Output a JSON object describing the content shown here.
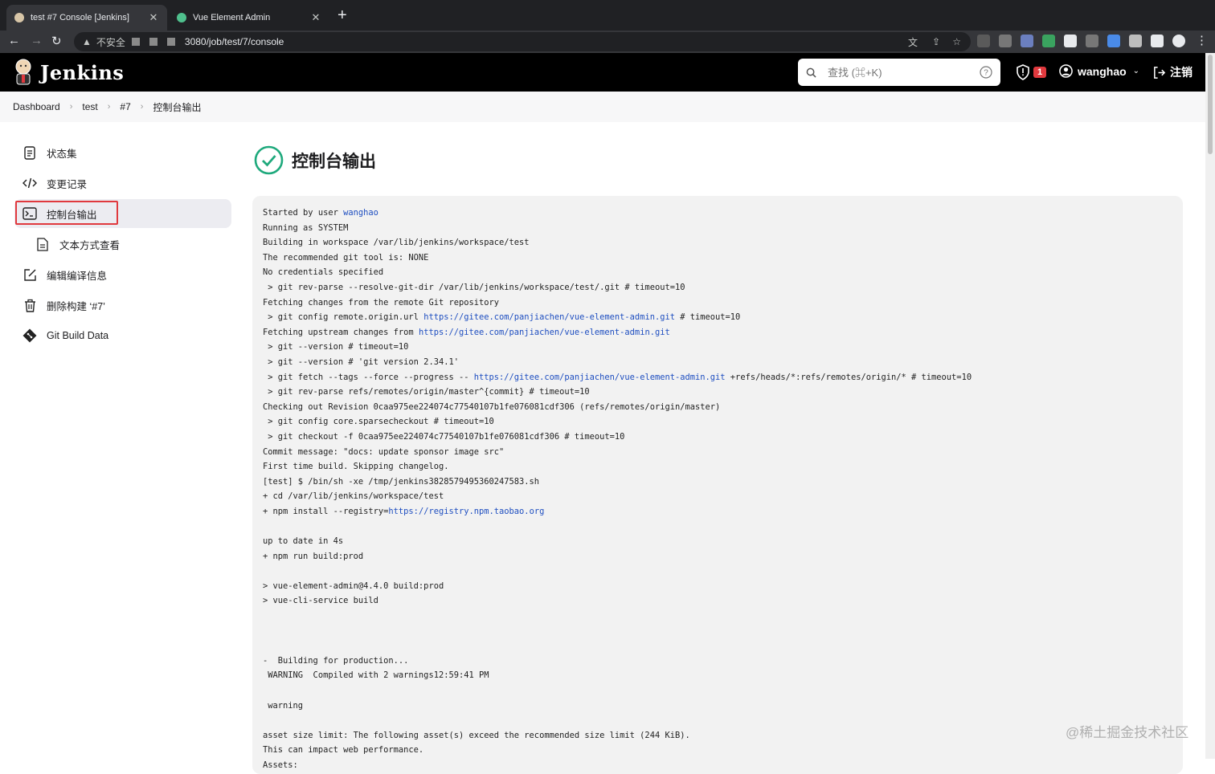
{
  "browser": {
    "tabs": [
      {
        "title": "test #7 Console [Jenkins]",
        "close": "✕"
      },
      {
        "title": "Vue Element Admin",
        "close": "✕"
      }
    ],
    "new_tab": "+",
    "insecure_label": "不安全",
    "url_fragment": "3080/job/test/7/console"
  },
  "header": {
    "title": "Jenkins",
    "search_placeholder": "查找 (⌘+K)",
    "alert_count": "1",
    "user": "wanghao",
    "logout": "注销"
  },
  "breadcrumb": [
    "Dashboard",
    "test",
    "#7",
    "控制台输出"
  ],
  "sidebar": {
    "items": [
      {
        "label": "状态集"
      },
      {
        "label": "变更记录"
      },
      {
        "label": "控制台输出"
      },
      {
        "label": "文本方式查看"
      },
      {
        "label": "编辑编译信息"
      },
      {
        "label": "删除构建 ‘#7’"
      },
      {
        "label": "Git Build Data"
      }
    ]
  },
  "page_title": "控制台输出",
  "console_lines": [
    [
      {
        "t": "Started by user "
      },
      {
        "t": "wanghao",
        "link": true
      }
    ],
    [
      {
        "t": "Running as SYSTEM"
      }
    ],
    [
      {
        "t": "Building in workspace /var/lib/jenkins/workspace/test"
      }
    ],
    [
      {
        "t": "The recommended git tool is: NONE"
      }
    ],
    [
      {
        "t": "No credentials specified"
      }
    ],
    [
      {
        "t": " > git rev-parse --resolve-git-dir /var/lib/jenkins/workspace/test/.git # timeout=10"
      }
    ],
    [
      {
        "t": "Fetching changes from the remote Git repository"
      }
    ],
    [
      {
        "t": " > git config remote.origin.url "
      },
      {
        "t": "https://gitee.com/panjiachen/vue-element-admin.git",
        "link": true
      },
      {
        "t": " # timeout=10"
      }
    ],
    [
      {
        "t": "Fetching upstream changes from "
      },
      {
        "t": "https://gitee.com/panjiachen/vue-element-admin.git",
        "link": true
      }
    ],
    [
      {
        "t": " > git --version # timeout=10"
      }
    ],
    [
      {
        "t": " > git --version # 'git version 2.34.1'"
      }
    ],
    [
      {
        "t": " > git fetch --tags --force --progress -- "
      },
      {
        "t": "https://gitee.com/panjiachen/vue-element-admin.git",
        "link": true
      },
      {
        "t": " +refs/heads/*:refs/remotes/origin/* # timeout=10"
      }
    ],
    [
      {
        "t": " > git rev-parse refs/remotes/origin/master^{commit} # timeout=10"
      }
    ],
    [
      {
        "t": "Checking out Revision 0caa975ee224074c77540107b1fe076081cdf306 (refs/remotes/origin/master)"
      }
    ],
    [
      {
        "t": " > git config core.sparsecheckout # timeout=10"
      }
    ],
    [
      {
        "t": " > git checkout -f 0caa975ee224074c77540107b1fe076081cdf306 # timeout=10"
      }
    ],
    [
      {
        "t": "Commit message: \"docs: update sponsor image src\""
      }
    ],
    [
      {
        "t": "First time build. Skipping changelog."
      }
    ],
    [
      {
        "t": "[test] $ /bin/sh -xe /tmp/jenkins3828579495360247583.sh"
      }
    ],
    [
      {
        "t": "+ cd /var/lib/jenkins/workspace/test"
      }
    ],
    [
      {
        "t": "+ npm install --registry="
      },
      {
        "t": "https://registry.npm.taobao.org",
        "link": true
      }
    ],
    [
      {
        "t": ""
      }
    ],
    [
      {
        "t": "up to date in 4s"
      }
    ],
    [
      {
        "t": "+ npm run build:prod"
      }
    ],
    [
      {
        "t": ""
      }
    ],
    [
      {
        "t": "> vue-element-admin@4.4.0 build:prod"
      }
    ],
    [
      {
        "t": "> vue-cli-service build"
      }
    ],
    [
      {
        "t": ""
      }
    ],
    [
      {
        "t": ""
      }
    ],
    [
      {
        "t": ""
      }
    ],
    [
      {
        "t": "-  Building for production..."
      }
    ],
    [
      {
        "t": " WARNING  Compiled with 2 warnings12:59:41 PM"
      }
    ],
    [
      {
        "t": ""
      }
    ],
    [
      {
        "t": " warning"
      }
    ],
    [
      {
        "t": ""
      }
    ],
    [
      {
        "t": "asset size limit: The following asset(s) exceed the recommended size limit (244 KiB)."
      }
    ],
    [
      {
        "t": "This can impact web performance."
      }
    ],
    [
      {
        "t": "Assets:"
      }
    ]
  ],
  "watermark": "@稀土掘金技术社区",
  "colors": {
    "accent": "#1e4ec0",
    "success": "#1ea97c",
    "danger": "#e0393e"
  }
}
